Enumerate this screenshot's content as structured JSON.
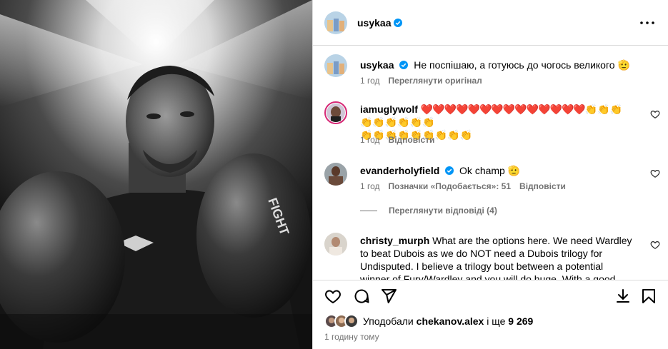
{
  "post": {
    "username": "usykaa",
    "verified": true,
    "more_label": "•••"
  },
  "caption": {
    "username": "usykaa",
    "text": "Не поспішаю, а готуюсь до чогось великого 🫡",
    "time": "1 год",
    "translate": "Переглянути оригінал"
  },
  "comments": [
    {
      "username": "iamuglywolf",
      "hearts": "❤️❤️❤️❤️❤️❤️❤️❤️❤️❤️❤️❤️❤️❤️",
      "hands_line1": "👏👏👏👏👏👏👏👏👏",
      "hands_line2": "👏👏👏👏👏👏👏👏👏",
      "time": "1 год",
      "reply": "Відповісти"
    },
    {
      "username": "evanderholyfield",
      "text": "Ok champ 🫡",
      "time": "1 год",
      "likes": "Позначки «Подобається»: 51",
      "reply": "Відповісти"
    },
    {
      "username": "christy_murph",
      "text": "What are the options here. We need Wardley to beat Dubois as we do NOT need a Dubois trilogy for Undisputed. I believe a trilogy bout between a potential winner of Fury/Wardley and you will do huge. With a good"
    }
  ],
  "view_replies": "Переглянути відповіді (4)",
  "liked_by": {
    "prefix": "Уподобали",
    "user": "chekanov.alex",
    "middle": "і ще",
    "count": "9 269"
  },
  "timestamp": "1 годину тому",
  "colors": {
    "verified": "#0095f6",
    "secondary_text": "#737373",
    "divider": "#dbdbdb",
    "story_ring_start": "#feda75",
    "story_ring_end": "#d62976"
  }
}
